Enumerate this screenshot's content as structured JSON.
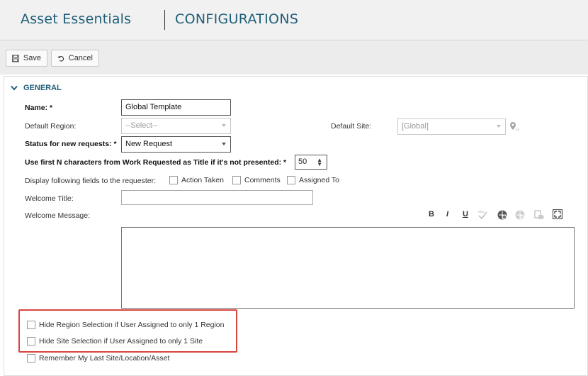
{
  "header": {
    "app_title": "Asset Essentials",
    "section_title": "CONFIGURATIONS"
  },
  "toolbar": {
    "save_label": "Save",
    "cancel_label": "Cancel"
  },
  "general": {
    "section_label": "GENERAL",
    "name_label": "Name: *",
    "name_value": "Global Template",
    "default_region_label": "Default Region:",
    "default_region_value": "--Select--",
    "default_site_label": "Default Site:",
    "default_site_value": "[Global]",
    "status_label": "Status for new requests: *",
    "status_value": "New Request",
    "first_n_label": "Use first N characters from Work Requested as Title if it's not presented: *",
    "first_n_value": "50",
    "display_fields_label": "Display following fields to the requester:",
    "display_fields": [
      {
        "label": "Action Taken",
        "checked": false
      },
      {
        "label": "Comments",
        "checked": false
      },
      {
        "label": "Assigned To",
        "checked": false
      }
    ],
    "welcome_title_label": "Welcome Title:",
    "welcome_title_value": "",
    "welcome_message_label": "Welcome Message:",
    "welcome_message_value": "",
    "editor_tools": {
      "bold": "B",
      "italic": "I",
      "underline": "U"
    },
    "options": [
      {
        "label": "Hide Region Selection if User Assigned to only 1 Region",
        "checked": false
      },
      {
        "label": "Hide Site Selection if User Assigned to only 1 Site",
        "checked": false
      },
      {
        "label": "Remember My Last Site/Location/Asset",
        "checked": false
      }
    ]
  },
  "colors": {
    "brand": "#1f5e78",
    "highlight": "#d9453f"
  }
}
